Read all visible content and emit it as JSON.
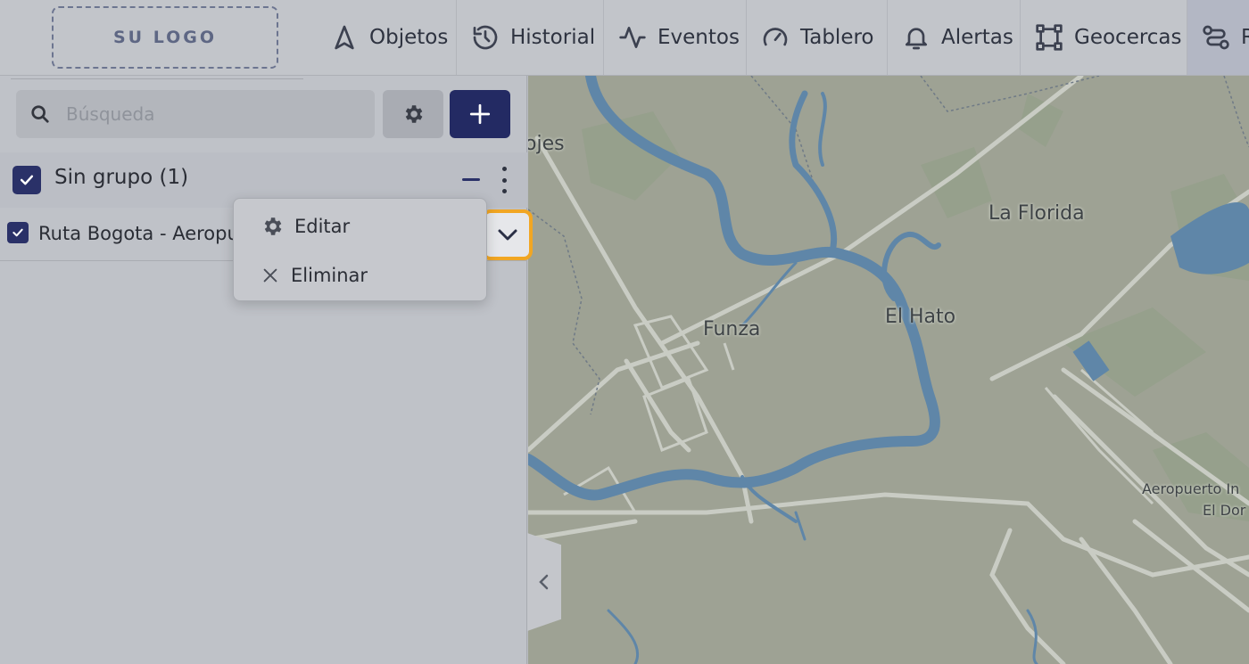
{
  "logo": {
    "text": "SU LOGO"
  },
  "nav": {
    "items": [
      {
        "label": "Objetos",
        "icon": "navigation-arrow-icon"
      },
      {
        "label": "Historial",
        "icon": "history-icon"
      },
      {
        "label": "Eventos",
        "icon": "activity-pulse-icon"
      },
      {
        "label": "Tablero",
        "icon": "gauge-icon"
      },
      {
        "label": "Alertas",
        "icon": "bell-icon"
      },
      {
        "label": "Geocercas",
        "icon": "geofence-square-icon"
      },
      {
        "label": "R",
        "icon": "route-icon"
      }
    ]
  },
  "panel": {
    "search_placeholder": "Búsqueda",
    "group": {
      "label": "Sin grupo (1)",
      "checked": true
    },
    "items": [
      {
        "label": "Ruta Bogota - Aeropuerto",
        "checked": true
      }
    ]
  },
  "context_menu": {
    "edit_label": "Editar",
    "delete_label": "Eliminar"
  },
  "map": {
    "places": {
      "partial_left": "ojes",
      "la_florida": "La Florida",
      "funza": "Funza",
      "el_hato": "El Hato",
      "airport_line1": "Aeropuerto In",
      "airport_line2": "El Dor"
    }
  },
  "colors": {
    "accent": "#232a63",
    "highlight": "#f1a623",
    "water": "#5f86a8"
  }
}
